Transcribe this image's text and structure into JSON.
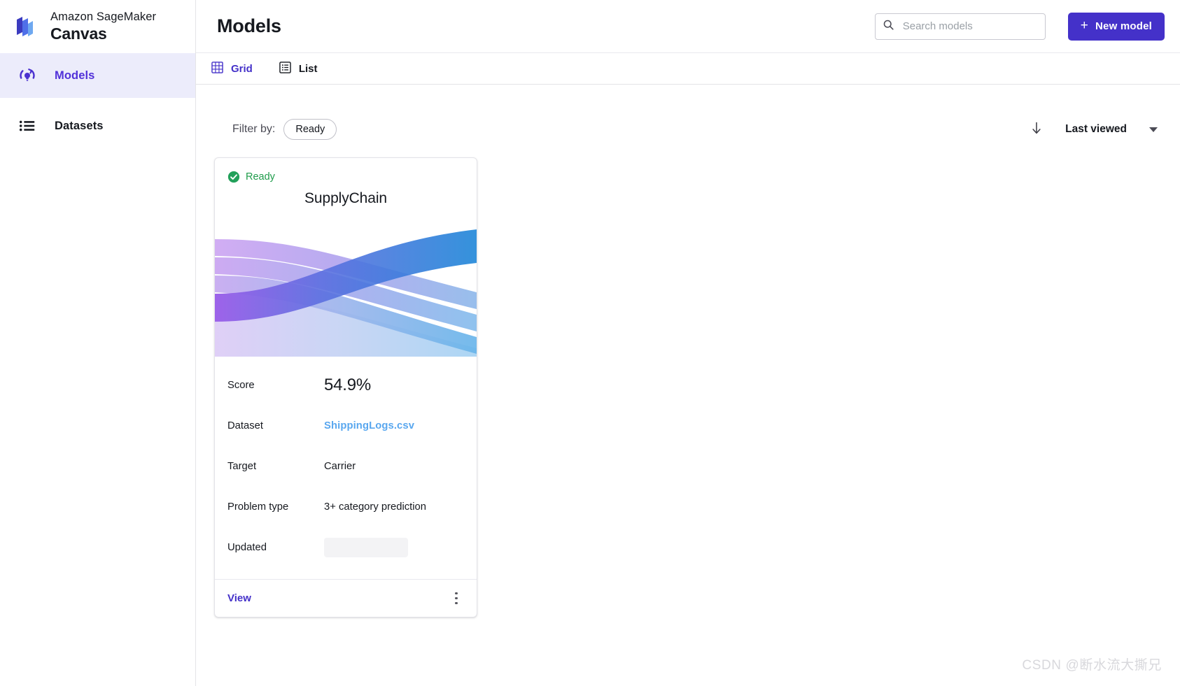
{
  "sidebar": {
    "brand": {
      "logo_icon": "sagemaker-logo-icon",
      "line1": "Amazon SageMaker",
      "line2": "Canvas"
    },
    "items": [
      {
        "label": "Models",
        "icon": "model-bulb-icon",
        "active": true
      },
      {
        "label": "Datasets",
        "icon": "list-icon",
        "active": false
      }
    ]
  },
  "header": {
    "title": "Models",
    "search": {
      "icon": "search-icon",
      "placeholder": "Search models",
      "value": ""
    },
    "new_model_button": {
      "label": "New model",
      "plus_icon": "plus-icon",
      "color": "#4431c9"
    }
  },
  "view_tabs": [
    {
      "label": "Grid",
      "icon": "grid-icon",
      "active": true
    },
    {
      "label": "List",
      "icon": "list-view-icon",
      "active": false
    }
  ],
  "filter_bar": {
    "label": "Filter by:",
    "chip": "Ready",
    "sort": {
      "direction_icon": "arrow-down-icon",
      "label": "Last viewed",
      "caret_icon": "chevron-down-icon"
    }
  },
  "cards": [
    {
      "status": {
        "icon": "check-circle-icon",
        "label": "Ready",
        "color": "#1f9c4b"
      },
      "title": "SupplyChain",
      "graphic": "sankey-flow-graphic",
      "rows": [
        {
          "label": "Score",
          "value": "54.9%",
          "style": "score"
        },
        {
          "label": "Dataset",
          "value": "ShippingLogs.csv",
          "style": "link"
        },
        {
          "label": "Target",
          "value": "Carrier",
          "style": "text"
        },
        {
          "label": "Problem type",
          "value": "3+ category prediction",
          "style": "text"
        },
        {
          "label": "Updated",
          "value": "",
          "style": "redacted"
        }
      ],
      "footer": {
        "view_label": "View",
        "menu_icon": "kebab-menu-icon"
      }
    }
  ],
  "watermark": "CSDN @断水流大撕兄",
  "chart_data": {
    "type": "sankey",
    "title": "SupplyChain model flow preview",
    "left_nodes": 5,
    "right_nodes": 5,
    "left_color": "#c39bf0",
    "left_accent_color": "#8b5cf6",
    "right_color": "#6fb6ea",
    "right_accent_color": "#2186d6"
  }
}
